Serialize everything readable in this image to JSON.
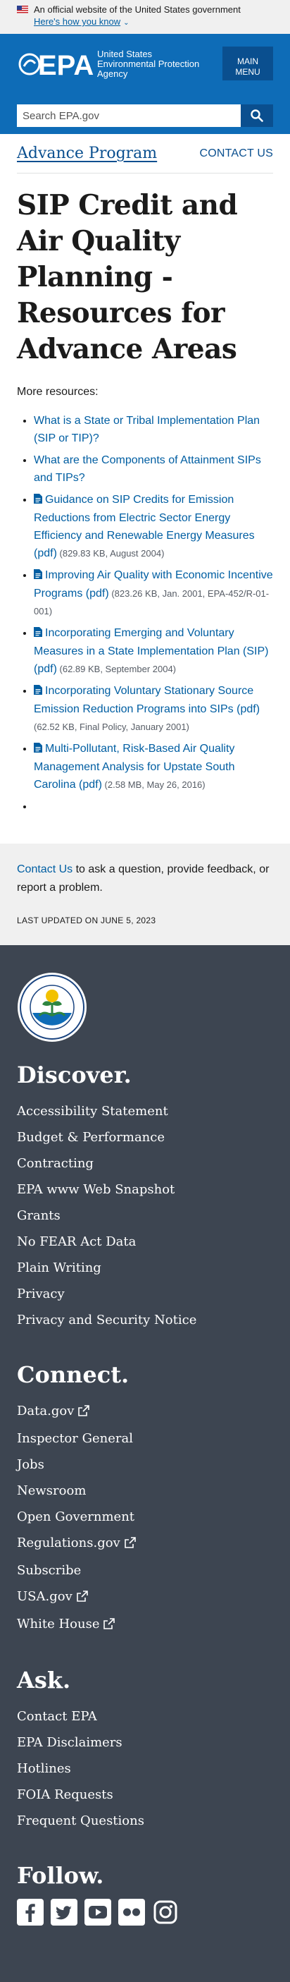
{
  "gov_banner": {
    "official": "An official website of the United States government",
    "how": "Here's how you know"
  },
  "header": {
    "logo_mark": "EPA",
    "logo_line1": "United States",
    "logo_line2": "Environmental Protection",
    "logo_line3": "Agency",
    "menu_line1": "MAIN",
    "menu_line2": "MENU",
    "search_placeholder": "Search EPA.gov"
  },
  "subnav": {
    "program": "Advance Program",
    "contact": "CONTACT US"
  },
  "page": {
    "title": "SIP Credit and Air Quality Planning - Resources for Advance Areas",
    "intro": "More resources:"
  },
  "resources": [
    {
      "pdf": false,
      "label": "What is a State or Tribal Implementation Plan (SIP or TIP)?",
      "meta": ""
    },
    {
      "pdf": false,
      "label": "What are the Components of Attainment SIPs and TIPs?",
      "meta": ""
    },
    {
      "pdf": true,
      "label": "Guidance on SIP Credits for Emission Reductions from Electric Sector Energy Efficiency and Renewable Energy Measures (pdf)",
      "meta": " (829.83 KB, August 2004)"
    },
    {
      "pdf": true,
      "label": "Improving Air Quality with Economic Incentive Programs (pdf)",
      "meta": " (823.26 KB, Jan. 2001, EPA-452/R-01-001)"
    },
    {
      "pdf": true,
      "label": "Incorporating Emerging and Voluntary Measures in a State Implementation Plan (SIP) (pdf)",
      "meta": " (62.89 KB, September 2004)"
    },
    {
      "pdf": true,
      "label": "Incorporating Voluntary Stationary Source Emission Reduction Programs into SIPs (pdf)",
      "meta": " (62.52 KB, Final Policy, January 2001)"
    },
    {
      "pdf": true,
      "label": "Multi-Pollutant, Risk-Based Air Quality Management Analysis for Upstate South Carolina (pdf)",
      "meta": " (2.58 MB, May 26, 2016)"
    }
  ],
  "contact_band": {
    "link": "Contact Us",
    "text": " to ask a question, provide feedback, or report a problem.",
    "updated": "LAST UPDATED ON JUNE 5, 2023"
  },
  "footer": {
    "discover_title": "Discover.",
    "discover": [
      "Accessibility Statement",
      "Budget & Performance",
      "Contracting",
      "EPA www Web Snapshot",
      "Grants",
      "No FEAR Act Data",
      "Plain Writing",
      "Privacy",
      "Privacy and Security Notice"
    ],
    "connect_title": "Connect.",
    "connect": [
      {
        "label": "Data.gov",
        "external": true
      },
      {
        "label": "Inspector General",
        "external": false
      },
      {
        "label": "Jobs",
        "external": false
      },
      {
        "label": "Newsroom",
        "external": false
      },
      {
        "label": "Open Government",
        "external": false
      },
      {
        "label": "Regulations.gov",
        "external": true
      },
      {
        "label": "Subscribe",
        "external": false
      },
      {
        "label": "USA.gov",
        "external": true
      },
      {
        "label": "White House",
        "external": true
      }
    ],
    "ask_title": "Ask.",
    "ask": [
      "Contact EPA",
      "EPA Disclaimers",
      "Hotlines",
      "FOIA Requests",
      "Frequent Questions"
    ],
    "follow_title": "Follow.",
    "social": [
      "facebook-icon",
      "twitter-icon",
      "youtube-icon",
      "flickr-icon",
      "instagram-icon"
    ]
  },
  "colors": {
    "header_blue": "#0e6cb7",
    "dark_blue": "#0a4f8f",
    "link": "#005ea2",
    "footer": "#3d4551"
  }
}
